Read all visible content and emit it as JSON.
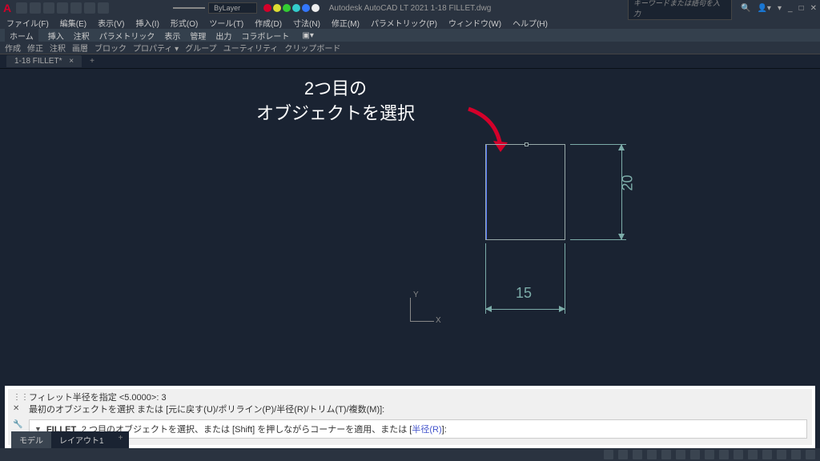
{
  "app": {
    "title_center": "Autodesk AutoCAD LT 2021   1-18 FILLET.dwg",
    "search_placeholder": "キーワードまたは語句を入力"
  },
  "menubar": [
    "ファイル(F)",
    "編集(E)",
    "表示(V)",
    "挿入(I)",
    "形式(O)",
    "ツール(T)",
    "作成(D)",
    "寸法(N)",
    "修正(M)",
    "パラメトリック(P)",
    "ウィンドウ(W)",
    "ヘルプ(H)"
  ],
  "ribbon_tabs": [
    "ホーム",
    "挿入",
    "注釈",
    "パラメトリック",
    "表示",
    "管理",
    "出力",
    "コラボレート"
  ],
  "ribbon_panels": [
    "作成",
    "修正",
    "注釈",
    "画層",
    "ブロック",
    "プロパティ ▾",
    "グループ",
    "ユーティリティ",
    "クリップボード"
  ],
  "layer": {
    "label": "ByLayer"
  },
  "doc_tab": "1-18 FILLET*",
  "annotation": {
    "line1": "2つ目の",
    "line2": "オブジェクトを選択"
  },
  "dims": {
    "v": "20",
    "h": "15"
  },
  "ucs": {
    "x": "X",
    "y": "Y"
  },
  "cmd": {
    "hist1": "フィレット半径を指定 <5.0000>: 3",
    "hist2": "最初のオブジェクトを選択 または [元に戻す(U)/ポリライン(P)/半径(R)/トリム(T)/複数(M)]:",
    "name": "FILLET",
    "prompt_pre": "2 つ目のオブジェクトを選択、または [Shift] を押しながらコーナーを適用、または [",
    "prompt_opt": "半径(R)",
    "prompt_post": "]:"
  },
  "layout_tabs": {
    "model": "モデル",
    "layout1": "レイアウト1"
  },
  "colors": {
    "red": "#d4002a",
    "green": "#3c3",
    "blue": "#37f",
    "yellow": "#dd3",
    "cyan": "#3cc",
    "white": "#eee"
  }
}
